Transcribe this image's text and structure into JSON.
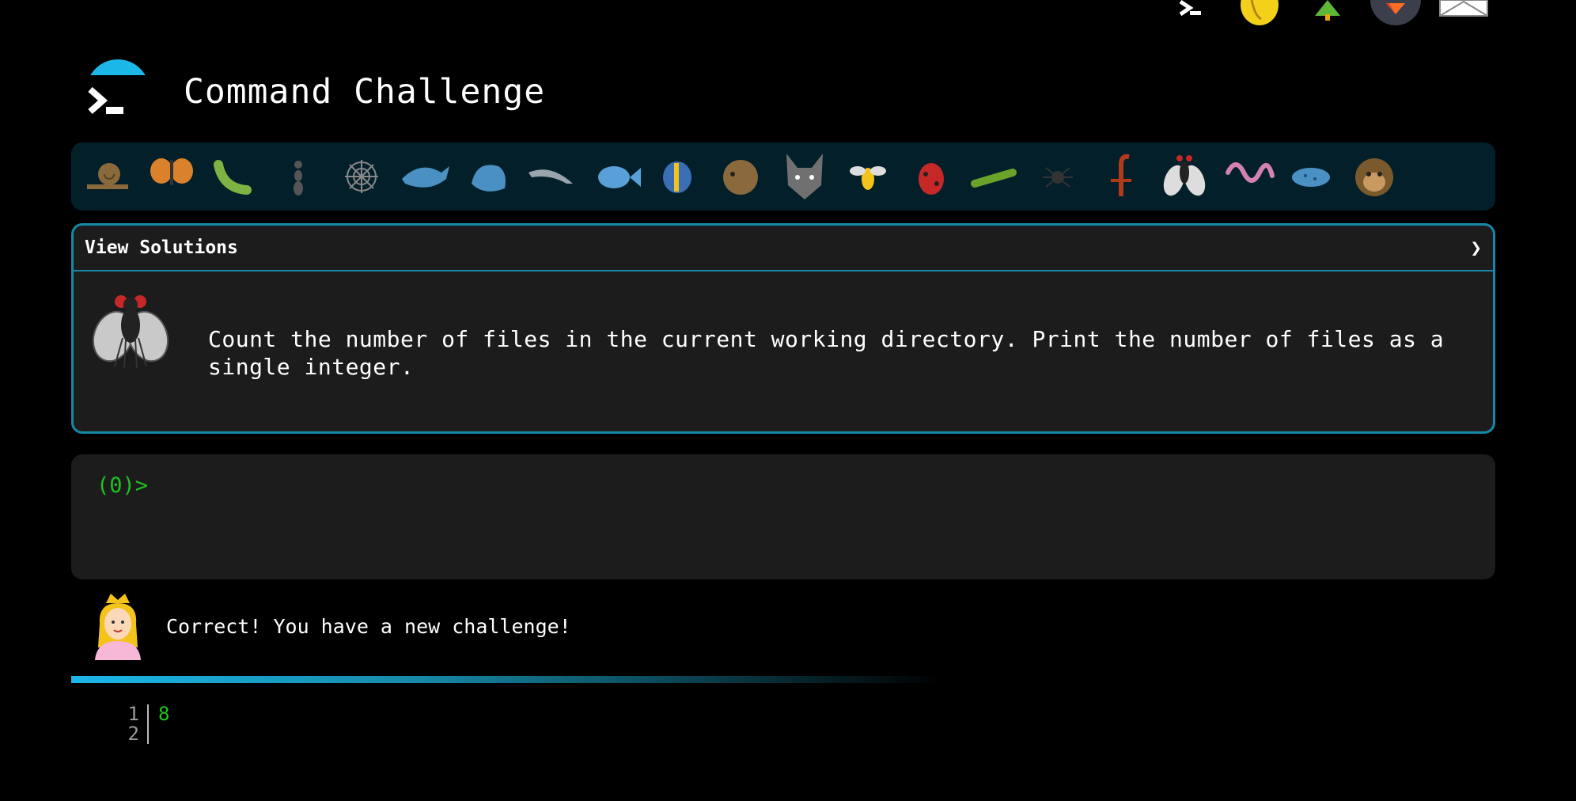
{
  "app": {
    "title": "Command Challenge",
    "logo_icon": "terminal-prompt-icon"
  },
  "top_icons": [
    "terminal-icon",
    "waving-hand-icon",
    "tree-icon",
    "gitlab-icon",
    "envelope-icon"
  ],
  "animals": [
    "snail",
    "butterfly",
    "bug",
    "ant",
    "spider-web",
    "whale",
    "spouting-whale",
    "dolphin",
    "fish",
    "tropical-fish",
    "blowfish",
    "wolf",
    "bee",
    "ladybug",
    "cricket",
    "spider",
    "scorpion",
    "fly",
    "worm",
    "microbe",
    "monkey"
  ],
  "challenge": {
    "header_label": "View Solutions",
    "chevron": "❯",
    "animal_icon": "fly-icon",
    "text": "Count the number of files in the current working directory. Print the number of files as a single integer."
  },
  "terminal": {
    "prompt": "(0)>",
    "input_value": "",
    "input_placeholder": ""
  },
  "message": {
    "avatar_icon": "princess-icon",
    "text": "Correct! You have a new challenge!"
  },
  "output": {
    "lines": [
      {
        "number": "1",
        "value": "8"
      },
      {
        "number": "2",
        "value": ""
      }
    ]
  },
  "colors": {
    "accent": "#1bb7e8",
    "border": "#1789a8",
    "prompt": "#1ec31e",
    "panel": "#1c1c1c",
    "strip": "#03202a"
  }
}
